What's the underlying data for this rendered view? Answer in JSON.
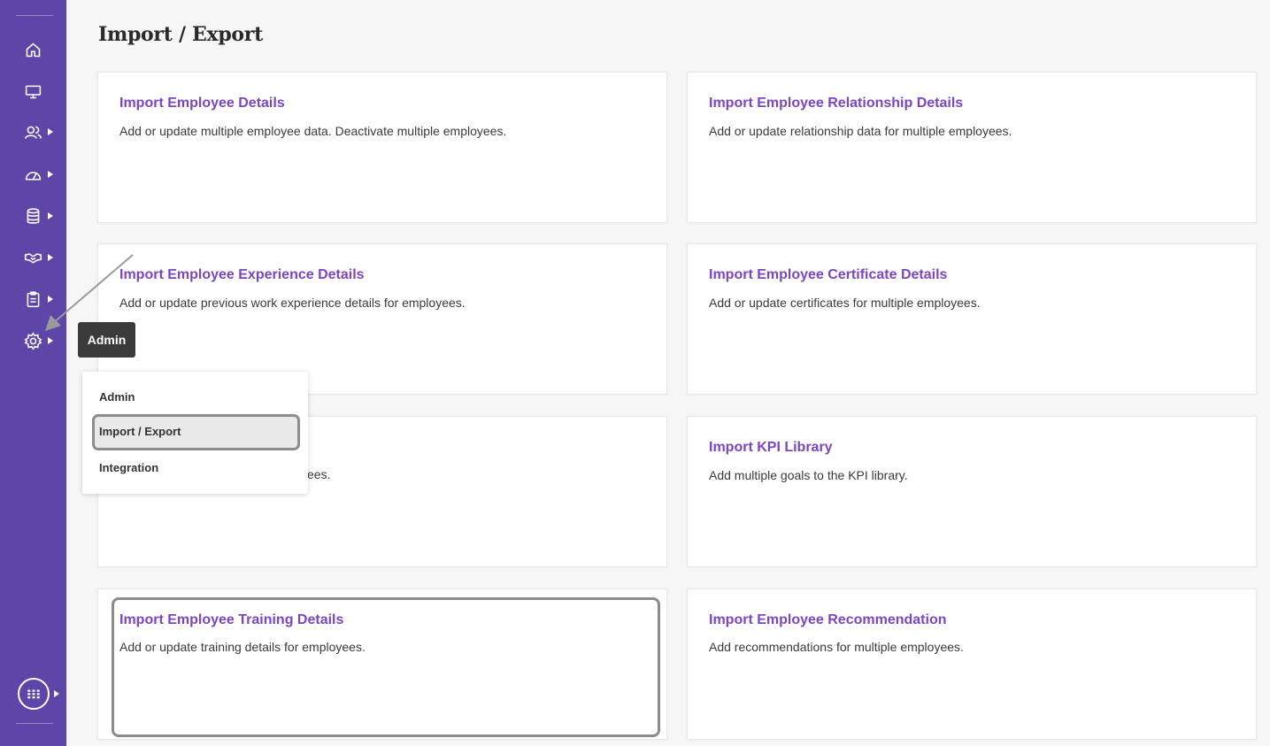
{
  "page": {
    "title": "Import / Export"
  },
  "sidebar": {
    "items": [
      {
        "icon": "home-icon",
        "has_submenu": false
      },
      {
        "icon": "monitor-icon",
        "has_submenu": false
      },
      {
        "icon": "people-icon",
        "has_submenu": true
      },
      {
        "icon": "dashboard-gauge-icon",
        "has_submenu": true
      },
      {
        "icon": "database-icon",
        "has_submenu": true
      },
      {
        "icon": "handshake-icon",
        "has_submenu": true
      },
      {
        "icon": "clipboard-icon",
        "has_submenu": true
      },
      {
        "icon": "settings-gear-icon",
        "has_submenu": true
      }
    ],
    "apps_icon": "apps-grid-icon"
  },
  "tooltip": {
    "text": "Admin"
  },
  "dropdown": {
    "items": [
      "Admin",
      "Import / Export",
      "Integration"
    ],
    "selected": "Import / Export"
  },
  "cards": [
    {
      "title": "Import Employee Details",
      "desc": "Add or update multiple employee data. Deactivate multiple employees."
    },
    {
      "title": "Import Employee Relationship Details",
      "desc": "Add or update relationship data for multiple employees."
    },
    {
      "title": "Import Employee Experience Details",
      "desc": "Add or update previous work experience details for employees."
    },
    {
      "title": "Import Employee Certificate Details",
      "desc": "Add or update certificates for multiple employees."
    },
    {
      "title": "",
      "desc": "ees."
    },
    {
      "title": "Import KPI Library",
      "desc": "Add multiple goals to the KPI library."
    },
    {
      "title": "Import Employee Training Details",
      "desc": "Add or update training details for employees."
    },
    {
      "title": "Import Employee Recommendation",
      "desc": "Add recommendations for multiple employees."
    }
  ],
  "colors": {
    "sidebar": "#5d46a8",
    "accent": "#7b45c3"
  }
}
